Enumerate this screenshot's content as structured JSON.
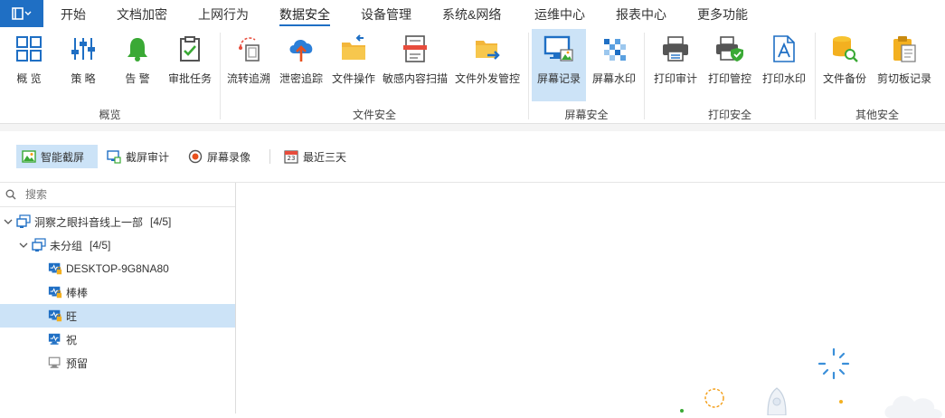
{
  "menu": {
    "items": [
      {
        "label": "开始"
      },
      {
        "label": "文档加密"
      },
      {
        "label": "上网行为"
      },
      {
        "label": "数据安全",
        "active": true
      },
      {
        "label": "设备管理"
      },
      {
        "label": "系统&网络"
      },
      {
        "label": "运维中心"
      },
      {
        "label": "报表中心"
      },
      {
        "label": "更多功能"
      }
    ]
  },
  "ribbon": {
    "groups": [
      {
        "label": "概览",
        "buttons": [
          {
            "label": "概 览",
            "icon": "grid-icon"
          },
          {
            "label": "策 略",
            "icon": "sliders-icon"
          },
          {
            "label": "告 警",
            "icon": "bell-icon"
          },
          {
            "label": "审批任务",
            "icon": "clipboard-check-icon"
          }
        ]
      },
      {
        "label": "文件安全",
        "buttons": [
          {
            "label": "流转追溯",
            "icon": "file-trace-icon"
          },
          {
            "label": "泄密追踪",
            "icon": "cloud-upload-icon"
          },
          {
            "label": "文件操作",
            "icon": "folder-icon"
          },
          {
            "label": "敏感内容扫描",
            "icon": "document-scan-icon"
          },
          {
            "label": "文件外发管控",
            "icon": "folder-send-icon"
          }
        ]
      },
      {
        "label": "屏幕安全",
        "buttons": [
          {
            "label": "屏幕记录",
            "icon": "monitor-image-icon",
            "active": true
          },
          {
            "label": "屏幕水印",
            "icon": "checker-icon"
          }
        ]
      },
      {
        "label": "打印安全",
        "buttons": [
          {
            "label": "打印审计",
            "icon": "printer-icon"
          },
          {
            "label": "打印管控",
            "icon": "printer-shield-icon"
          },
          {
            "label": "打印水印",
            "icon": "document-a-icon"
          }
        ]
      },
      {
        "label": "其他安全",
        "buttons": [
          {
            "label": "文件备份",
            "icon": "database-search-icon"
          },
          {
            "label": "剪切板记录",
            "icon": "clipboard-icon"
          }
        ]
      }
    ]
  },
  "toolbar": {
    "smart_capture": "智能截屏",
    "capture_audit": "截屏审计",
    "screen_record": "屏幕录像",
    "date_range": "最近三天",
    "calendar_day": "23"
  },
  "tree": {
    "search_placeholder": "搜索",
    "root": {
      "label": "洞察之眼抖音线上一部",
      "count": "[4/5]"
    },
    "group": {
      "label": "未分组",
      "count": "[4/5]"
    },
    "devices": [
      {
        "label": "DESKTOP-9G8NA80",
        "status": "online-locked"
      },
      {
        "label": "棒棒",
        "status": "online-locked"
      },
      {
        "label": "旺",
        "status": "online-locked",
        "selected": true
      },
      {
        "label": "祝",
        "status": "online"
      },
      {
        "label": "预留",
        "status": "offline"
      }
    ]
  },
  "colors": {
    "accent": "#1f6fc4",
    "selected_bg": "#cce3f7",
    "orange": "#f39c12",
    "green": "#3aa935"
  }
}
